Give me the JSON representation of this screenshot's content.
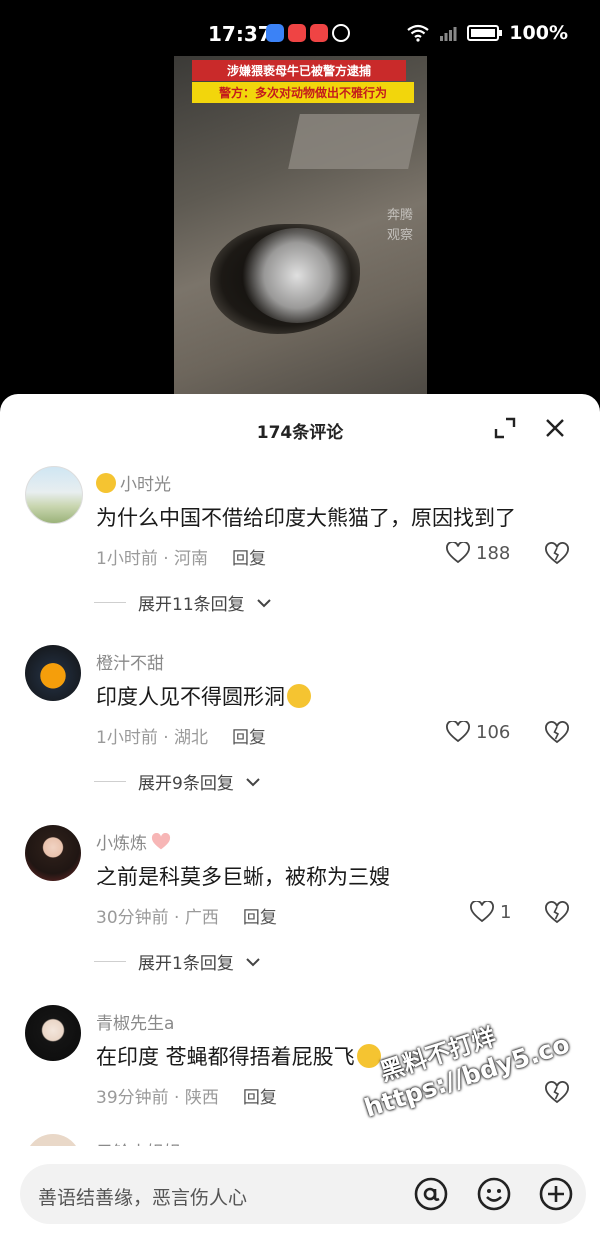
{
  "status": {
    "time": "17:37",
    "battery": "100%",
    "app_icons": [
      "#3b82f6",
      "#ef4444",
      "#ef4444",
      "#ffffff"
    ]
  },
  "video": {
    "caption_line1": "涉嫌猥亵母牛已被警方逮捕",
    "caption_line2": "警方：多次对动物做出不雅行为",
    "corner_watermark": "奔腾 观察"
  },
  "comments_panel": {
    "title": "174条评论"
  },
  "comments": [
    {
      "username": "小时光",
      "text": "为什么中国不借给印度大熊猫了，原因找到了",
      "time": "1小时前",
      "location": "河南",
      "reply_label": "回复",
      "likes": "188",
      "expand_label": "展开11条回复"
    },
    {
      "username": "橙汁不甜",
      "text": "印度人见不得圆形洞",
      "time": "1小时前",
      "location": "湖北",
      "reply_label": "回复",
      "likes": "106",
      "expand_label": "展开9条回复"
    },
    {
      "username": "小炼炼",
      "text": "之前是科莫多巨蜥，被称为三嫂",
      "time": "30分钟前",
      "location": "广西",
      "reply_label": "回复",
      "likes": "1",
      "expand_label": "展开1条回复"
    },
    {
      "username": "青椒先生a",
      "text": "在印度 苍蝇都得捂着屁股飞",
      "time": "39分钟前",
      "location": "陕西",
      "reply_label": "回复",
      "likes": ""
    },
    {
      "username": "子铃小姐姐"
    }
  ],
  "input": {
    "placeholder": "善语结善缘，恶言伤人心"
  },
  "overlay_watermark": {
    "line1": "黑料不打烊",
    "line2": "https://bdy5.co"
  }
}
